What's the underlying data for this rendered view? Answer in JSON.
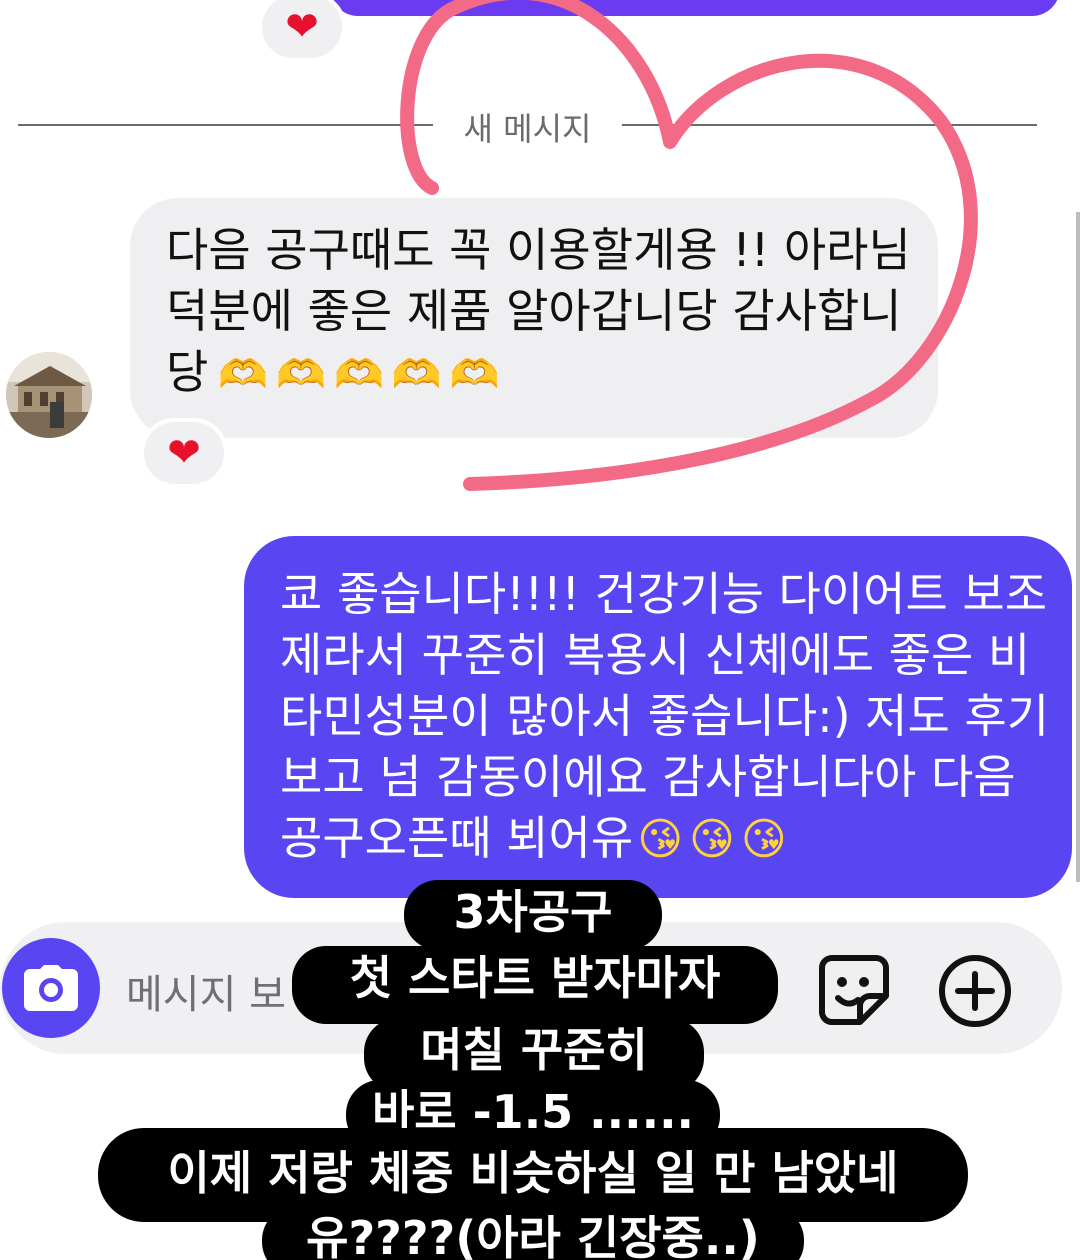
{
  "reactions": {
    "top": "❤",
    "incoming": "❤"
  },
  "divider_label": "새 메시지",
  "incoming_message": {
    "lines": [
      "다음 공구때도 꼭 이용할게용 !! 아라님",
      "덕분에 좋은 제품 알아갑니당 감사합니",
      "당"
    ],
    "emojis": "🫶🫶🫶🫶🫶"
  },
  "outgoing_message": {
    "lines": [
      "쿄 좋습니다!!!! 건강기능 다이어트 보조",
      "제라서 꾸준히 복용시 신체에도 좋은 비",
      "타민성분이 많아서 좋습니다:) 저도 후기",
      "보고 넘 감동이에요 감사합니다아 다음",
      "공구오픈때 뵈어유"
    ],
    "emojis": "😘😘😘"
  },
  "composer": {
    "placeholder": "메시지 보"
  },
  "caption": {
    "line1": "3차공구",
    "line2": "첫 스타트 받자마자",
    "line3": "며칠 꾸준히",
    "line4": "바로 -1.5 ......",
    "line5": "이제 저랑 체중 비슷하실 일 만 남았네",
    "line6": "유????(아라 긴장중..)"
  },
  "icons": {
    "camera": "camera-icon",
    "sticker": "sticker-icon",
    "plus": "plus-circle-icon"
  },
  "colors": {
    "accent": "#5a45f2",
    "bubble_in": "#efeff1",
    "heart_scribble": "#f26a86",
    "caption_bg": "#000000"
  }
}
